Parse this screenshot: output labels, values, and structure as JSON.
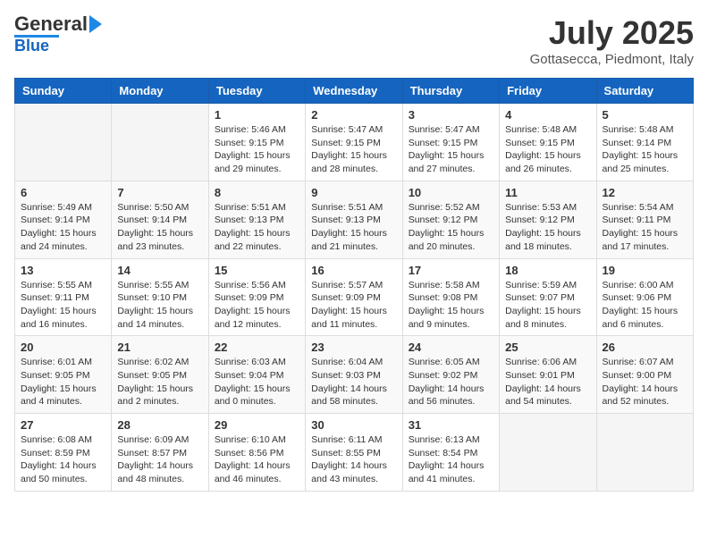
{
  "header": {
    "logo_general": "General",
    "logo_blue": "Blue",
    "month_title": "July 2025",
    "subtitle": "Gottasecca, Piedmont, Italy"
  },
  "weekdays": [
    "Sunday",
    "Monday",
    "Tuesday",
    "Wednesday",
    "Thursday",
    "Friday",
    "Saturday"
  ],
  "weeks": [
    [
      {
        "day": "",
        "info": ""
      },
      {
        "day": "",
        "info": ""
      },
      {
        "day": "1",
        "info": "Sunrise: 5:46 AM\nSunset: 9:15 PM\nDaylight: 15 hours\nand 29 minutes."
      },
      {
        "day": "2",
        "info": "Sunrise: 5:47 AM\nSunset: 9:15 PM\nDaylight: 15 hours\nand 28 minutes."
      },
      {
        "day": "3",
        "info": "Sunrise: 5:47 AM\nSunset: 9:15 PM\nDaylight: 15 hours\nand 27 minutes."
      },
      {
        "day": "4",
        "info": "Sunrise: 5:48 AM\nSunset: 9:15 PM\nDaylight: 15 hours\nand 26 minutes."
      },
      {
        "day": "5",
        "info": "Sunrise: 5:48 AM\nSunset: 9:14 PM\nDaylight: 15 hours\nand 25 minutes."
      }
    ],
    [
      {
        "day": "6",
        "info": "Sunrise: 5:49 AM\nSunset: 9:14 PM\nDaylight: 15 hours\nand 24 minutes."
      },
      {
        "day": "7",
        "info": "Sunrise: 5:50 AM\nSunset: 9:14 PM\nDaylight: 15 hours\nand 23 minutes."
      },
      {
        "day": "8",
        "info": "Sunrise: 5:51 AM\nSunset: 9:13 PM\nDaylight: 15 hours\nand 22 minutes."
      },
      {
        "day": "9",
        "info": "Sunrise: 5:51 AM\nSunset: 9:13 PM\nDaylight: 15 hours\nand 21 minutes."
      },
      {
        "day": "10",
        "info": "Sunrise: 5:52 AM\nSunset: 9:12 PM\nDaylight: 15 hours\nand 20 minutes."
      },
      {
        "day": "11",
        "info": "Sunrise: 5:53 AM\nSunset: 9:12 PM\nDaylight: 15 hours\nand 18 minutes."
      },
      {
        "day": "12",
        "info": "Sunrise: 5:54 AM\nSunset: 9:11 PM\nDaylight: 15 hours\nand 17 minutes."
      }
    ],
    [
      {
        "day": "13",
        "info": "Sunrise: 5:55 AM\nSunset: 9:11 PM\nDaylight: 15 hours\nand 16 minutes."
      },
      {
        "day": "14",
        "info": "Sunrise: 5:55 AM\nSunset: 9:10 PM\nDaylight: 15 hours\nand 14 minutes."
      },
      {
        "day": "15",
        "info": "Sunrise: 5:56 AM\nSunset: 9:09 PM\nDaylight: 15 hours\nand 12 minutes."
      },
      {
        "day": "16",
        "info": "Sunrise: 5:57 AM\nSunset: 9:09 PM\nDaylight: 15 hours\nand 11 minutes."
      },
      {
        "day": "17",
        "info": "Sunrise: 5:58 AM\nSunset: 9:08 PM\nDaylight: 15 hours\nand 9 minutes."
      },
      {
        "day": "18",
        "info": "Sunrise: 5:59 AM\nSunset: 9:07 PM\nDaylight: 15 hours\nand 8 minutes."
      },
      {
        "day": "19",
        "info": "Sunrise: 6:00 AM\nSunset: 9:06 PM\nDaylight: 15 hours\nand 6 minutes."
      }
    ],
    [
      {
        "day": "20",
        "info": "Sunrise: 6:01 AM\nSunset: 9:05 PM\nDaylight: 15 hours\nand 4 minutes."
      },
      {
        "day": "21",
        "info": "Sunrise: 6:02 AM\nSunset: 9:05 PM\nDaylight: 15 hours\nand 2 minutes."
      },
      {
        "day": "22",
        "info": "Sunrise: 6:03 AM\nSunset: 9:04 PM\nDaylight: 15 hours\nand 0 minutes."
      },
      {
        "day": "23",
        "info": "Sunrise: 6:04 AM\nSunset: 9:03 PM\nDaylight: 14 hours\nand 58 minutes."
      },
      {
        "day": "24",
        "info": "Sunrise: 6:05 AM\nSunset: 9:02 PM\nDaylight: 14 hours\nand 56 minutes."
      },
      {
        "day": "25",
        "info": "Sunrise: 6:06 AM\nSunset: 9:01 PM\nDaylight: 14 hours\nand 54 minutes."
      },
      {
        "day": "26",
        "info": "Sunrise: 6:07 AM\nSunset: 9:00 PM\nDaylight: 14 hours\nand 52 minutes."
      }
    ],
    [
      {
        "day": "27",
        "info": "Sunrise: 6:08 AM\nSunset: 8:59 PM\nDaylight: 14 hours\nand 50 minutes."
      },
      {
        "day": "28",
        "info": "Sunrise: 6:09 AM\nSunset: 8:57 PM\nDaylight: 14 hours\nand 48 minutes."
      },
      {
        "day": "29",
        "info": "Sunrise: 6:10 AM\nSunset: 8:56 PM\nDaylight: 14 hours\nand 46 minutes."
      },
      {
        "day": "30",
        "info": "Sunrise: 6:11 AM\nSunset: 8:55 PM\nDaylight: 14 hours\nand 43 minutes."
      },
      {
        "day": "31",
        "info": "Sunrise: 6:13 AM\nSunset: 8:54 PM\nDaylight: 14 hours\nand 41 minutes."
      },
      {
        "day": "",
        "info": ""
      },
      {
        "day": "",
        "info": ""
      }
    ]
  ]
}
